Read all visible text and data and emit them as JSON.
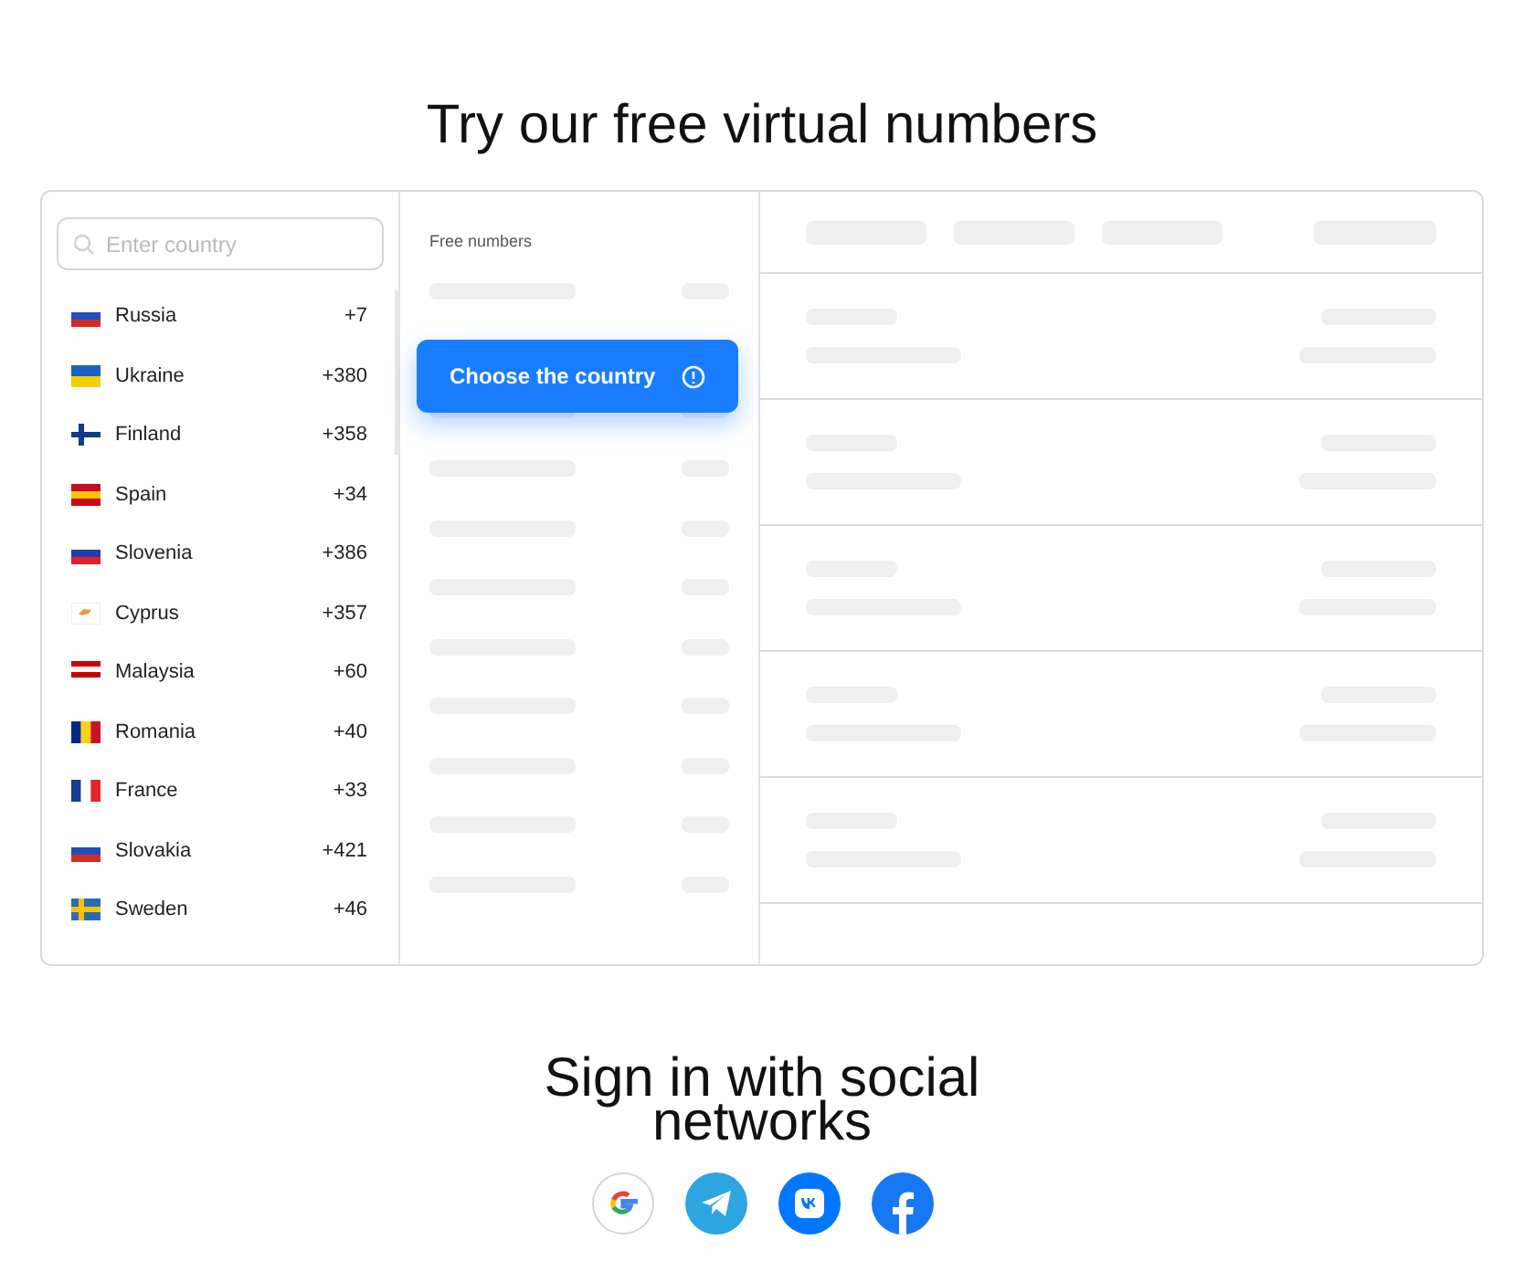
{
  "title": "Try our free virtual numbers",
  "search": {
    "placeholder": "Enter country"
  },
  "countries": [
    {
      "name": "Russia",
      "code": "+7"
    },
    {
      "name": "Ukraine",
      "code": "+380"
    },
    {
      "name": "Finland",
      "code": "+358"
    },
    {
      "name": "Spain",
      "code": "+34"
    },
    {
      "name": "Slovenia",
      "code": "+386"
    },
    {
      "name": "Cyprus",
      "code": "+357"
    },
    {
      "name": "Malaysia",
      "code": "+60"
    },
    {
      "name": "Romania",
      "code": "+40"
    },
    {
      "name": "France",
      "code": "+33"
    },
    {
      "name": "Slovakia",
      "code": "+421"
    },
    {
      "name": "Sweden",
      "code": "+46"
    }
  ],
  "free_numbers": {
    "heading": "Free numbers"
  },
  "tooltip": {
    "text": "Choose the country"
  },
  "social": {
    "heading": "Sign in with social networks",
    "providers": [
      {
        "kind": "google"
      },
      {
        "kind": "telegram"
      },
      {
        "kind": "vk"
      },
      {
        "kind": "facebook"
      }
    ]
  }
}
